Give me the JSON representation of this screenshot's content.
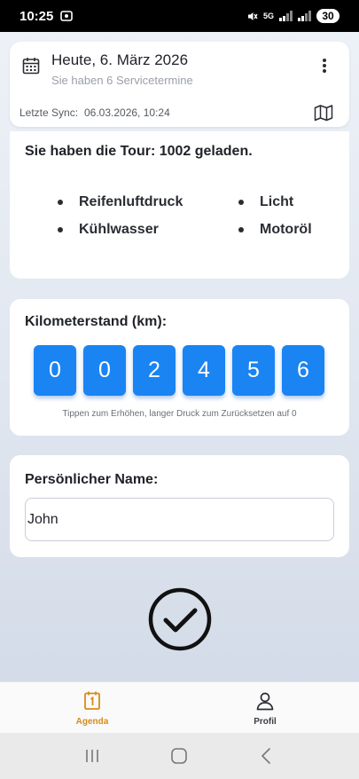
{
  "status_bar": {
    "time": "10:25",
    "network": "5G",
    "battery": "30"
  },
  "header": {
    "title": "Heute, 6. März 2026",
    "subtitle": "Sie haben 6 Servicetermine",
    "sync_label": "Letzte Sync:",
    "sync_value": "06.03.2026, 10:24",
    "icons": {
      "calendar": "calendar-icon",
      "menu": "more-vertical-icon",
      "map": "map-icon"
    }
  },
  "tour": {
    "text": "Sie haben die Tour: 1002 geladen.",
    "items": [
      "Reifenluftdruck",
      "Licht",
      "Kühlwasser",
      "Motoröl"
    ]
  },
  "odometer": {
    "label": "Kilometerstand (km):",
    "digits": [
      "0",
      "0",
      "2",
      "4",
      "5",
      "6"
    ],
    "hint": "Tippen zum Erhöhen, langer Druck zum Zurücksetzen auf 0",
    "accent": "#1a84f3"
  },
  "name_field": {
    "label": "Persönlicher Name:",
    "value": "John"
  },
  "confirm": {
    "icon": "check-circle-icon"
  },
  "bottom_nav": {
    "items": [
      {
        "label": "Agenda",
        "icon": "agenda-icon",
        "active": true,
        "color": "#d78a1a"
      },
      {
        "label": "Profil",
        "icon": "person-icon",
        "active": false,
        "color": "#3a3d44"
      }
    ]
  },
  "system_nav": {
    "icons": [
      "recents-icon",
      "home-icon",
      "back-icon"
    ]
  }
}
